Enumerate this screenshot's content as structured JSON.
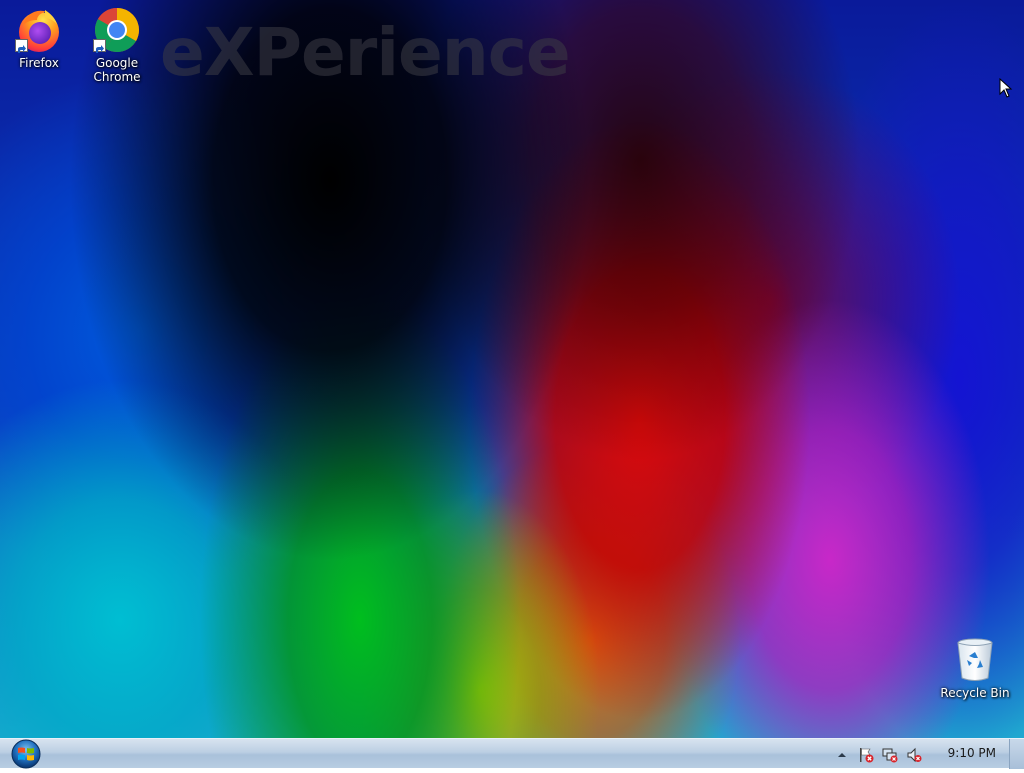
{
  "desktop": {
    "watermark": "eXPerience",
    "icons": [
      {
        "label": "Firefox",
        "icon": "firefox-icon"
      },
      {
        "label": "Google\nChrome",
        "label_line1": "Google",
        "label_line2": "Chrome",
        "icon": "chrome-icon"
      },
      {
        "label": "Recycle Bin",
        "icon": "recycle-bin-icon"
      }
    ]
  },
  "taskbar": {
    "start_icon": "windows-logo-icon",
    "tray": {
      "icons": [
        "show-hidden-icons-chevron",
        "action-center-flag-error-icon",
        "network-disconnected-icon",
        "volume-muted-icon"
      ],
      "clock": "9:10 PM"
    }
  },
  "colors": {
    "taskbar": "#bccfe3",
    "label_text": "#ffffff",
    "clock_text": "#1a1a1a"
  }
}
